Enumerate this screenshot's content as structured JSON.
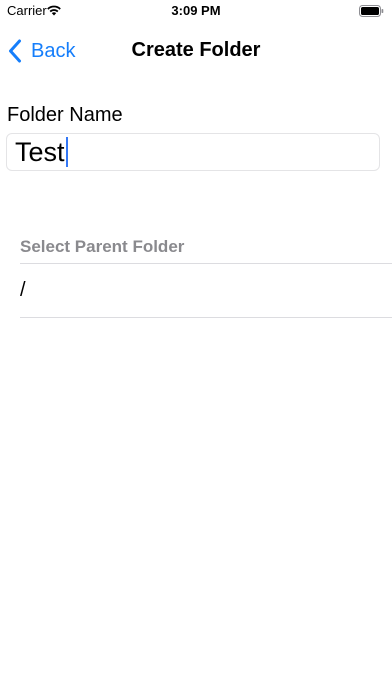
{
  "status_bar": {
    "carrier": "Carrier",
    "time": "3:09 PM"
  },
  "nav": {
    "back_label": "Back",
    "title": "Create Folder"
  },
  "form": {
    "folder_name_label": "Folder Name",
    "folder_name_value": "Test",
    "parent_section_header": "Select Parent Folder",
    "parent_value": "/"
  },
  "colors": {
    "accent": "#157efb",
    "secondary_text": "#8a8a8e",
    "separator": "#dcdce0"
  },
  "icons": {
    "wifi": "wifi-icon",
    "battery": "battery-icon",
    "back": "chevron-left-icon"
  }
}
